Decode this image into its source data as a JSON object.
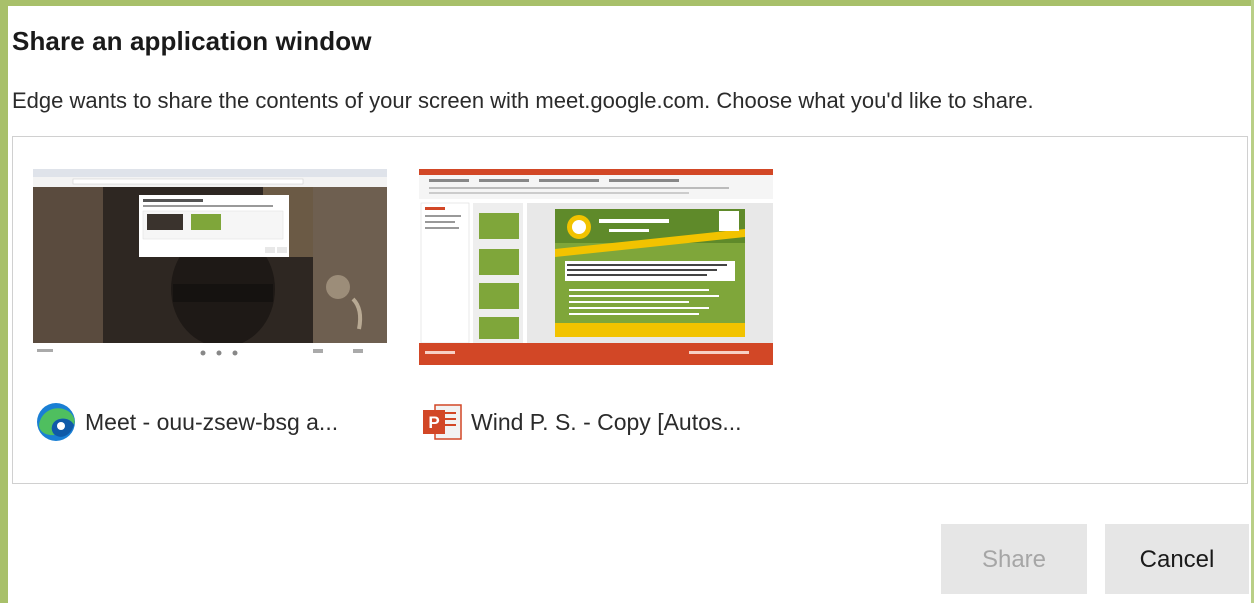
{
  "dialog": {
    "title": "Share an application window",
    "description": "Edge wants to share the contents of your screen with meet.google.com. Choose what you'd like to share."
  },
  "sources": [
    {
      "label": "Meet - ouu-zsew-bsg a...",
      "icon": "edge-icon"
    },
    {
      "label": "Wind P. S. - Copy [Autos...",
      "icon": "powerpoint-icon"
    }
  ],
  "buttons": {
    "share": "Share",
    "cancel": "Cancel"
  },
  "colors": {
    "frame": "#a8c06a",
    "slide_green": "#7fa63a",
    "slide_yellow": "#f2c300",
    "edge_blue": "#1a7fd4",
    "edge_green": "#4fbf5f",
    "powerpoint_orange": "#d24726"
  }
}
